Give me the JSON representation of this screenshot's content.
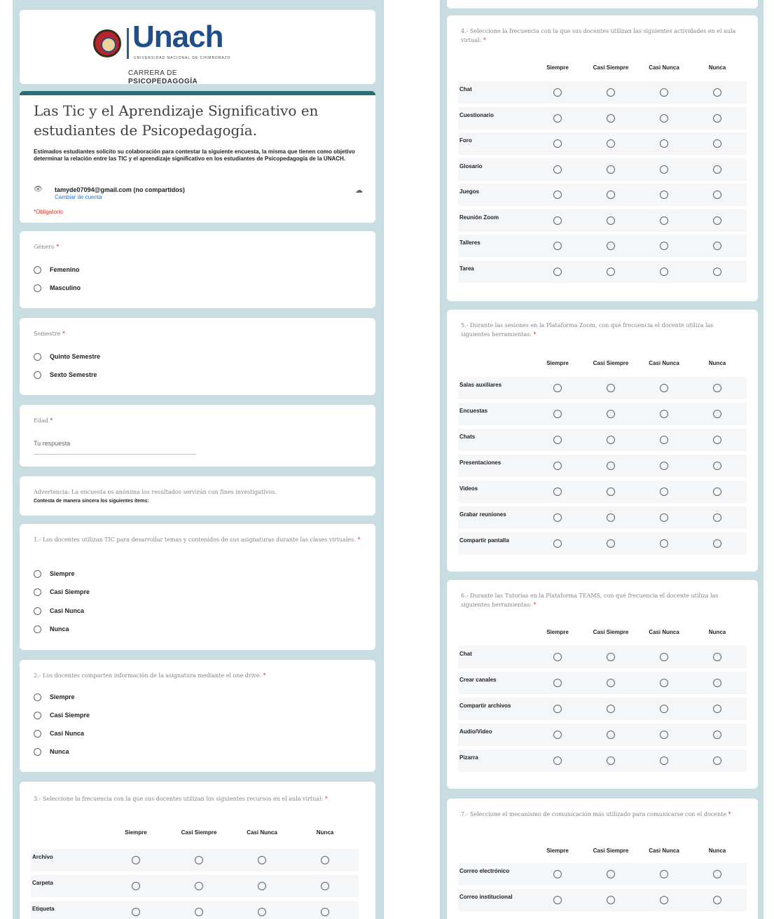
{
  "header": {
    "brand": "Unach",
    "brand_sub": "UNIVERSIDAD NACIONAL DE CHIMBORAZO",
    "career_line1": "CARRERA DE",
    "career_line2": "PSICOPEDAGOGÍA"
  },
  "form": {
    "title": "Las Tic y el Aprendizaje Significativo en estudiantes de Psicopedagogía.",
    "description": "Estimados estudiantes solicito su colaboración para contestar la siguiente encuesta, la misma que tienen como objetivo determinar la relación entre las TIC y el aprendizaje significativo en los estudiantes de Psicopedagogía de la UNACH.",
    "email": "tamyde07094@gmail.com (no compartidos)",
    "switch_account": "Cambiar de cuenta",
    "required_note": "*Obligatorio"
  },
  "questions": {
    "genero": {
      "label": "Género",
      "options": [
        "Femenino",
        "Masculino"
      ]
    },
    "semestre": {
      "label": "Semestre",
      "options": [
        "Quinto Semestre",
        "Sexto Semestre"
      ]
    },
    "edad": {
      "label": "Edad",
      "placeholder": "Tu respuesta"
    },
    "advertencia": {
      "text": "Advertencia: La encuesta es anónima los resultados servirán con fines investigativos.",
      "sub": "Contesta de manera sincera los siguientes ítems:"
    },
    "q1": {
      "label": "1.- Los docentes utilizan TIC para desarrollar temas y contenidos de sus asignaturas durante las clases virtuales.",
      "options": [
        "Siempre",
        "Casi Siempre",
        "Casi Nunca",
        "Nunca"
      ]
    },
    "q2": {
      "label": "2.- Los docentes comparten información de la asignatura mediante el one drive.",
      "options": [
        "Siempre",
        "Casi Siempre",
        "Casi Nunca",
        "Nunca"
      ]
    },
    "q3": {
      "label": "3.- Seleccione la frecuencia con la que sus docentes utilizan los siguientes recursos en el aula virtual:",
      "rows": [
        "Archivo",
        "Carpeta",
        "Etiqueta"
      ]
    },
    "q4": {
      "label": "4.- Seleccione la frecuencia con la que sus docentes utilizan las siguientes actividades en el aula virtual:",
      "rows": [
        "Chat",
        "Cuestionario",
        "Foro",
        "Glosario",
        "Juegos",
        "Reunión Zoom",
        "Talleres",
        "Tarea"
      ]
    },
    "q5": {
      "label": "5.- Durante las sesiones en la Plataforma Zoom, con qué frecuencia el docente utiliza las siguientes herramientas:",
      "rows": [
        "Salas auxiliares",
        "Encuestas",
        "Chats",
        "Presentaciones",
        "Videos",
        "Grabar reuniones",
        "Compartir pantalla"
      ]
    },
    "q6": {
      "label": "6.- Durante las Tutorías en la Plataforma TEAMS, con qué frecuencia el docente utiliza las siguientes herramientas:",
      "rows": [
        "Chat",
        "Crear canales",
        "Compartir archivos",
        "Audio/Video",
        "Pizarra"
      ]
    },
    "q7": {
      "label": "7.- Seleccione el mecanismo de comunicación más utilizado para comunicarse con el docente",
      "rows": [
        "Correo electrónico",
        "Correo institucional"
      ]
    }
  },
  "grid_columns": [
    "Siempre",
    "Casi Siempre",
    "Casi Nunca",
    "Nunca"
  ],
  "colors": {
    "background": "#c8dde1",
    "accent": "#1f4e8a",
    "required": "#d93025",
    "link": "#1a73e8",
    "header_bar": "#2b6b74"
  }
}
